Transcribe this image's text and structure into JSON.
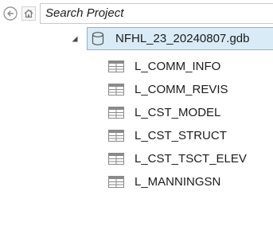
{
  "search": {
    "placeholder": "Search Project"
  },
  "icons": {
    "back": "back-arrow-icon",
    "home": "home-icon",
    "expander": "expanded-triangle-icon",
    "geodatabase": "database-icon",
    "table": "table-icon"
  },
  "colors": {
    "selection_fill": "#d9ebf7",
    "selection_border": "#7fb6e0"
  },
  "tree": {
    "geodatabase": {
      "label": "NFHL_23_20240807.gdb",
      "expanded": true,
      "selected": true
    },
    "tables": [
      {
        "label": "L_COMM_INFO"
      },
      {
        "label": "L_COMM_REVIS"
      },
      {
        "label": "L_CST_MODEL"
      },
      {
        "label": "L_CST_STRUCT"
      },
      {
        "label": "L_CST_TSCT_ELEV"
      },
      {
        "label": "L_MANNINGSN"
      }
    ]
  }
}
